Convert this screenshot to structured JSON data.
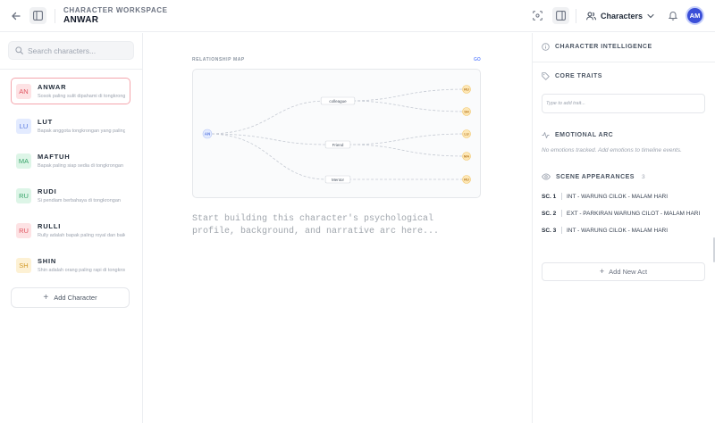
{
  "header": {
    "workspace_label": "CHARACTER WORKSPACE",
    "character_name": "ANWAR",
    "characters_menu_label": "Characters",
    "avatar_initials": "AM"
  },
  "sidebar": {
    "search_placeholder": "Search characters...",
    "characters": [
      {
        "initials": "AN",
        "name": "ANWAR",
        "desc": "Sosok paling sulit dipahami di tongkrongan",
        "bg": "#fde2e4",
        "fg": "#e05561",
        "active": true
      },
      {
        "initials": "LU",
        "name": "LUT",
        "desc": "Bapak anggota tongkrongan yang paling tua",
        "bg": "#e3ebff",
        "fg": "#5b7be0",
        "active": false
      },
      {
        "initials": "MA",
        "name": "MAFTUH",
        "desc": "Bapak paling siap sedia di tongkrongan",
        "bg": "#ddf5e7",
        "fg": "#3aa56b",
        "active": false
      },
      {
        "initials": "RU",
        "name": "RUDI",
        "desc": "Si pendiam berbahaya di tongkrongan",
        "bg": "#ddf5e7",
        "fg": "#3aa56b",
        "active": false
      },
      {
        "initials": "RU",
        "name": "RULLI",
        "desc": "Rully adalah bapak paling royal dan baik",
        "bg": "#fde2e4",
        "fg": "#e05561",
        "active": false
      },
      {
        "initials": "SH",
        "name": "SHIN",
        "desc": "Shin adalah orang paling rapi di tongkrongan",
        "bg": "#fdf1d4",
        "fg": "#d39a2a",
        "active": false
      }
    ],
    "add_character_label": "Add Character"
  },
  "main": {
    "relationship_label": "RELATIONSHIP MAP",
    "relationship_link": "GO",
    "map": {
      "center": "AN",
      "groups": [
        "colleague",
        "Friend",
        "Mentor"
      ],
      "nodes": [
        {
          "label": "RU",
          "group": 0
        },
        {
          "label": "SH",
          "group": 0
        },
        {
          "label": "LU",
          "group": 1
        },
        {
          "label": "MA",
          "group": 1
        },
        {
          "label": "RU",
          "group": 2
        }
      ]
    },
    "notes_placeholder": "Start building this character's psychological\nprofile, background, and narrative arc here..."
  },
  "right_panel": {
    "intelligence_title": "CHARACTER INTELLIGENCE",
    "core_traits_title": "CORE TRAITS",
    "trait_placeholder": "Type to add trait...",
    "emotional_arc_title": "EMOTIONAL ARC",
    "emotional_empty": "No emotions tracked. Add emotions to timeline events.",
    "scene_title": "SCENE APPEARANCES",
    "scene_count": "3",
    "scenes": [
      {
        "code": "SC. 1",
        "text": "INT - WARUNG CILOK - MALAM HARI"
      },
      {
        "code": "SC. 2",
        "text": "EXT - PARKIRAN WARUNG CILOT - MALAM HARI"
      },
      {
        "code": "SC. 3",
        "text": "INT - WARUNG CILOK - MALAM HARI"
      }
    ],
    "add_act_label": "Add New Act"
  }
}
